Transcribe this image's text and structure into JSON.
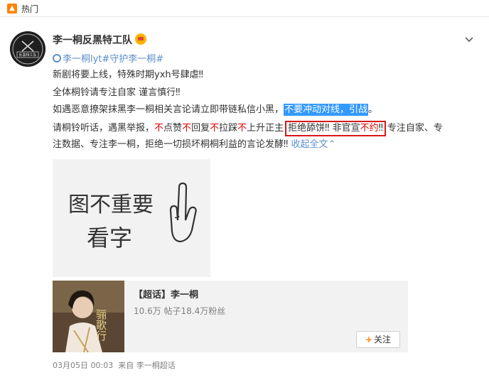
{
  "hot_bar": {
    "icon": "fire-icon",
    "label": "热门"
  },
  "post": {
    "author": "李一桐反黑特工队",
    "badge_icon": "crown-badge-icon",
    "avatar_text": "反黑特工队",
    "tags_prefix": "李一桐lyt#守护李一桐#",
    "tags_link_icon": "link-icon",
    "line1": "新剧将要上线，特殊时期yxh号肆虐‼",
    "line2": "全体桐铃请专注自家 谨言慎行‼",
    "line3_normal": "如遇恶意撩架抹黑李一桐相关言论请立即带链私信小黑，",
    "line3_highlight": "不要冲动对线，引战",
    "line3_end": "。",
    "line4_a": "请桐铃听话，遇黑举报，",
    "line4_r1": "不",
    "line4_b": "点赞",
    "line4_r2": "不",
    "line4_c": "回复",
    "line4_r3": "不",
    "line4_d": "拉踩",
    "line4_r4": "不",
    "line4_e": "上升正主",
    "line4_box_a": "拒绝舔饼‼ 非官宣",
    "line4_box_red": "不约",
    "line4_box_b": "‼",
    "line4_f": "专注自家、专",
    "line5": "注数据、专注李一桐，拒绝一切损坏桐桐利益的言论发酵‼",
    "expand_label": "收起全文",
    "meme_text_line1": "图不重要",
    "meme_text_line2": "看字"
  },
  "topic": {
    "title": "【超话】李一桐",
    "stats": "10.6万 帖子18.4万粉丝",
    "follow_label": "关注",
    "thumb_text": "骊歌行"
  },
  "meta": {
    "time": "03月05日 00:03",
    "source": "来自 李一桐超话"
  },
  "colors": {
    "link": "#5d8fc9",
    "highlight": "#3399ff",
    "emphasis_red": "#e00000",
    "box_border": "#d81818",
    "hot_orange": "#ff8200"
  }
}
